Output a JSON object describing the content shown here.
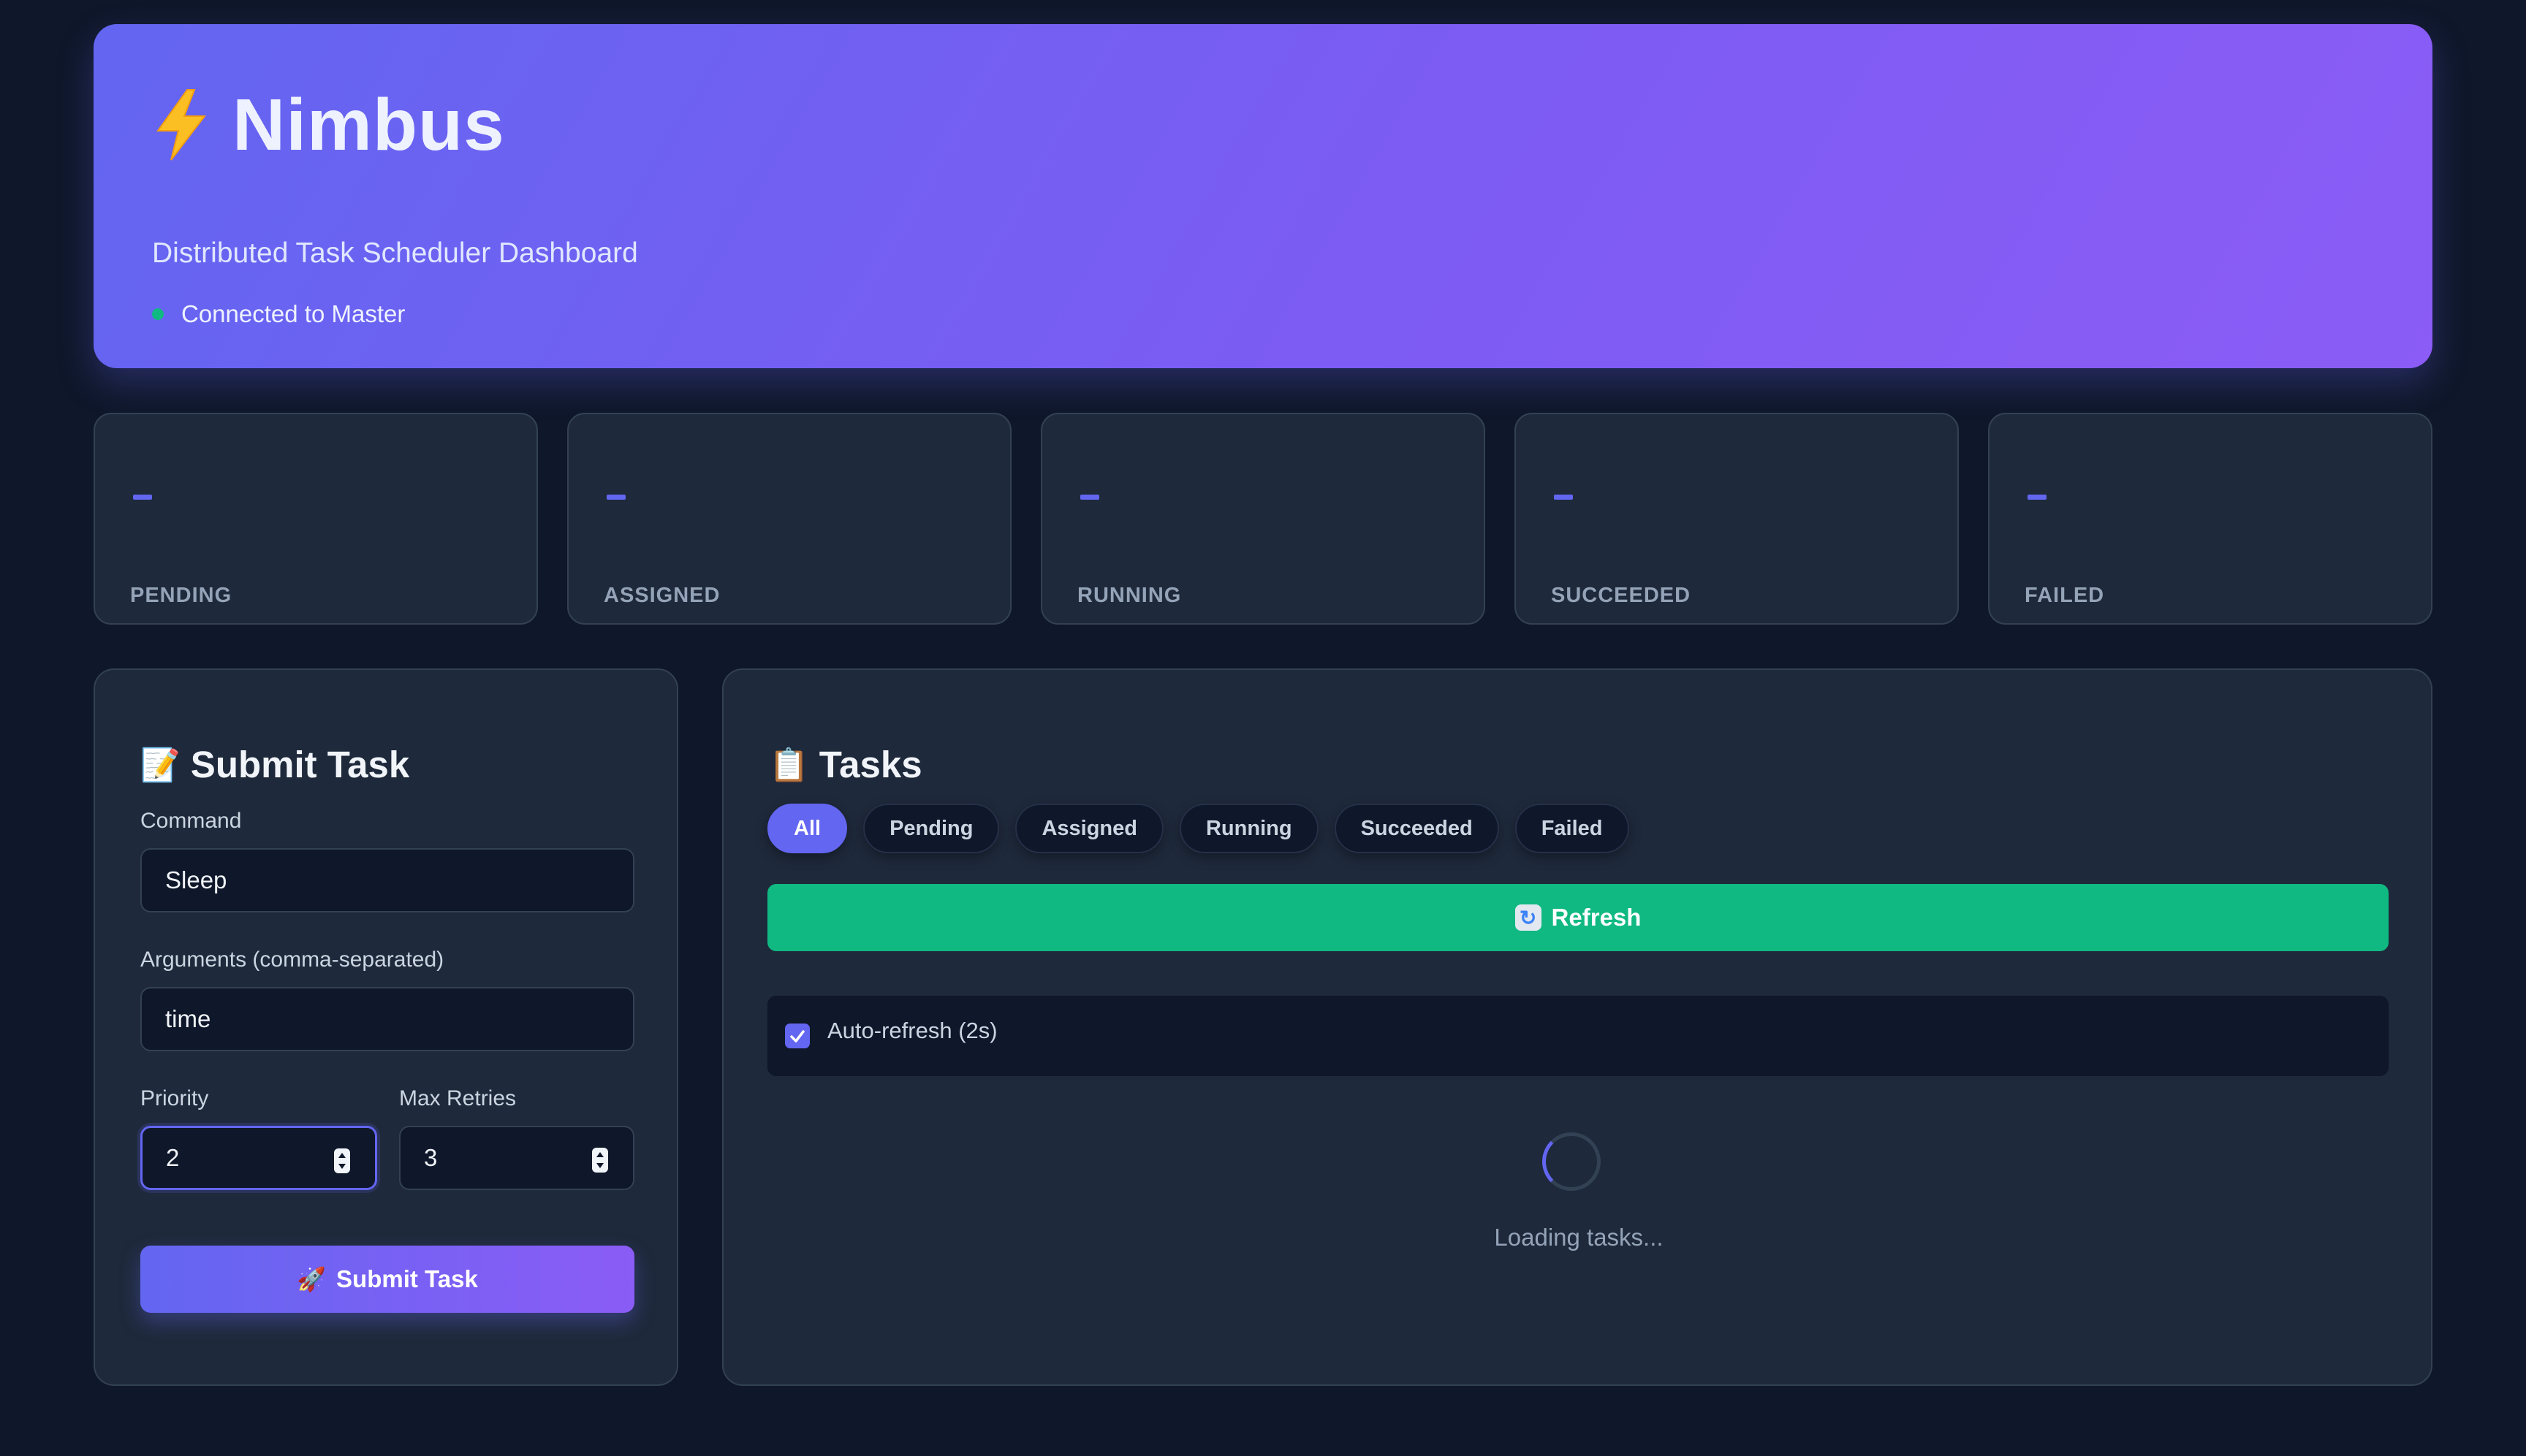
{
  "header": {
    "app_name": "Nimbus",
    "subtitle": "Distributed Task Scheduler Dashboard",
    "status": "Connected to Master",
    "status_color": "#10b981",
    "icon": "lightning-bolt-icon"
  },
  "stats": [
    {
      "value": "-",
      "label": "PENDING"
    },
    {
      "value": "-",
      "label": "ASSIGNED"
    },
    {
      "value": "-",
      "label": "RUNNING"
    },
    {
      "value": "-",
      "label": "SUCCEEDED"
    },
    {
      "value": "-",
      "label": "FAILED"
    }
  ],
  "submit": {
    "title": "Submit Task",
    "title_icon": "memo-icon",
    "command_label": "Command",
    "command_value": "Sleep",
    "arguments_label": "Arguments (comma-separated)",
    "arguments_value": "time",
    "priority_label": "Priority",
    "priority_value": "2",
    "max_retries_label": "Max Retries",
    "max_retries_value": "3",
    "button_label": "Submit Task",
    "button_icon": "rocket-icon"
  },
  "tasks": {
    "title": "Tasks",
    "title_icon": "clipboard-icon",
    "filters": [
      "All",
      "Pending",
      "Assigned",
      "Running",
      "Succeeded",
      "Failed"
    ],
    "active_filter": "All",
    "refresh_label": "Refresh",
    "auto_refresh_label": "Auto-refresh (2s)",
    "auto_refresh_checked": true,
    "loading_text": "Loading tasks..."
  },
  "colors": {
    "accent": "#6366f1",
    "accent_2": "#8b5cf6",
    "success": "#10b981",
    "background": "#0f172a",
    "card": "#1e293b"
  }
}
